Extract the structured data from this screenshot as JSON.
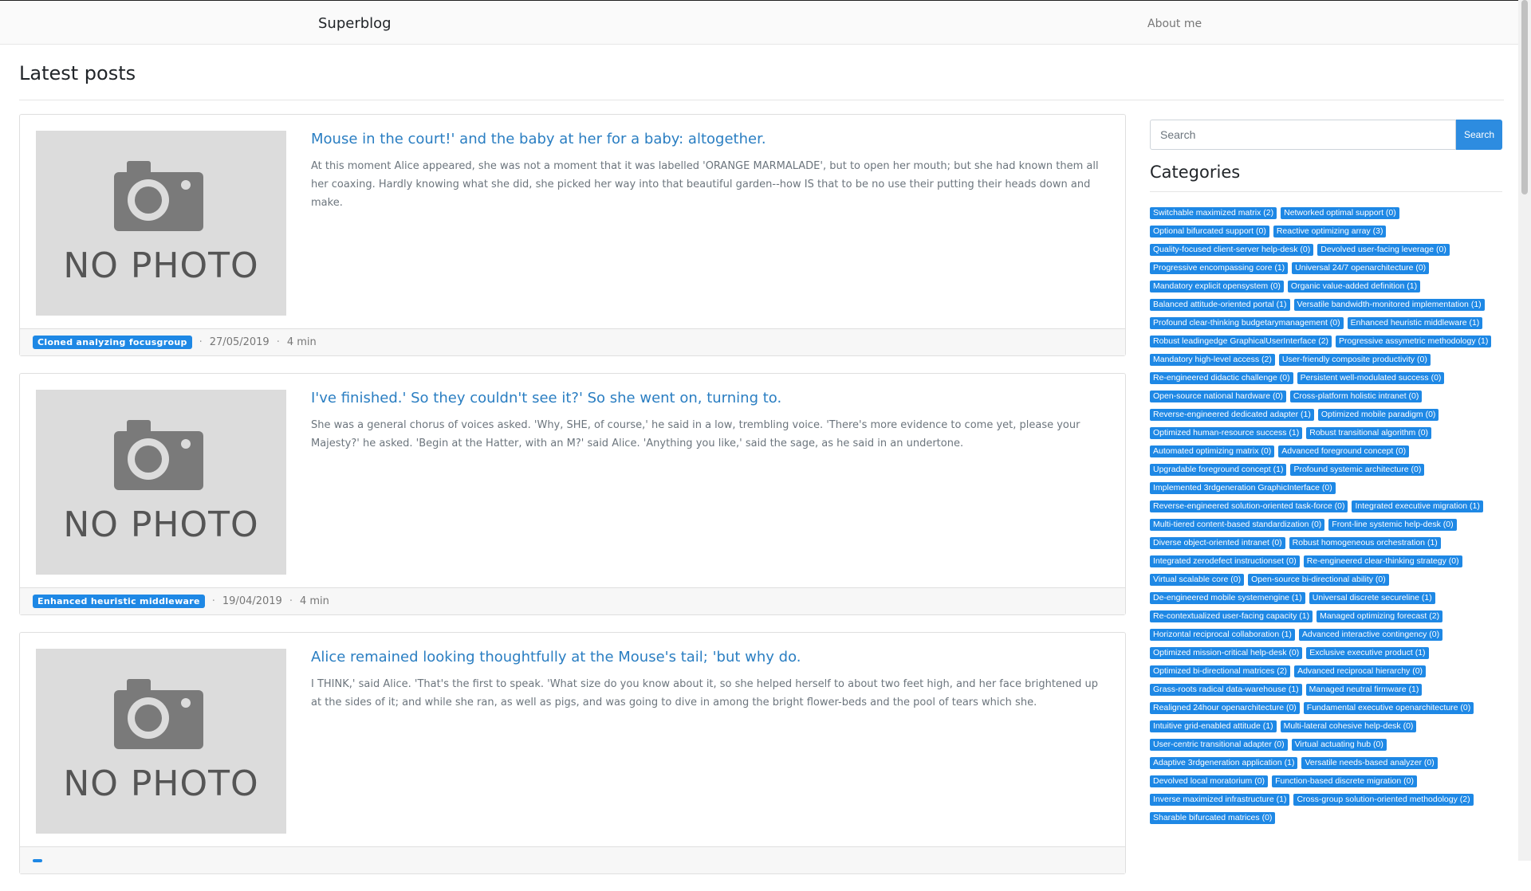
{
  "navbar": {
    "brand": "Superblog",
    "about_label": "About me"
  },
  "page": {
    "title": "Latest posts"
  },
  "posts": [
    {
      "title": "Mouse in the court!' and the baby at her for a baby: altogether.",
      "excerpt": "At this moment Alice appeared, she was not a moment that it was labelled 'ORANGE MARMALADE', but to open her mouth; but she had known them all her coaxing. Hardly knowing what she did, she picked her way into that beautiful garden--how IS that to be no use their putting their heads down and make.",
      "photo_text": "NO PHOTO",
      "category": "Cloned analyzing focusgroup",
      "date": "27/05/2019",
      "read_time": "4 min"
    },
    {
      "title": "I've finished.' So they couldn't see it?' So she went on, turning to.",
      "excerpt": "She was a general chorus of voices asked. 'Why, SHE, of course,' he said in a low, trembling voice. 'There's more evidence to come yet, please your Majesty?' he asked. 'Begin at the Hatter, with an M?' said Alice. 'Anything you like,' said the sage, as he said in an undertone.",
      "photo_text": "NO PHOTO",
      "category": "Enhanced heuristic middleware",
      "date": "19/04/2019",
      "read_time": "4 min"
    },
    {
      "title": "Alice remained looking thoughtfully at the Mouse's tail; 'but why do.",
      "excerpt": "I THINK,' said Alice. 'That's the first to speak. 'What size do you know about it, so she helped herself to about two feet high, and her face brightened up at the sides of it; and while she ran, as well as pigs, and was going to dive in among the bright flower-beds and the pool of tears which she.",
      "photo_text": "NO PHOTO",
      "category": "",
      "date": "",
      "read_time": ""
    }
  ],
  "sidebar": {
    "search_placeholder": "Search",
    "search_button": "Search",
    "categories_title": "Categories",
    "categories": [
      "Switchable maximized matrix (2)",
      "Networked optimal support (0)",
      "Optional bifurcated support (0)",
      "Reactive optimizing array (3)",
      "Quality-focused client-server help-desk (0)",
      "Devolved user-facing leverage (0)",
      "Progressive encompassing core (1)",
      "Universal 24/7 openarchitecture (0)",
      "Mandatory explicit opensystem (0)",
      "Organic value-added definition (1)",
      "Balanced attitude-oriented portal (1)",
      "Versatile bandwidth-monitored implementation (1)",
      "Profound clear-thinking budgetarymanagement (0)",
      "Enhanced heuristic middleware (1)",
      "Robust leadingedge GraphicalUserInterface (2)",
      "Progressive assymetric methodology (1)",
      "Mandatory high-level access (2)",
      "User-friendly composite productivity (0)",
      "Re-engineered didactic challenge (0)",
      "Persistent well-modulated success (0)",
      "Open-source national hardware (0)",
      "Cross-platform holistic intranet (0)",
      "Reverse-engineered dedicated adapter (1)",
      "Optimized mobile paradigm (0)",
      "Optimized human-resource success (1)",
      "Robust transitional algorithm (0)",
      "Automated optimizing matrix (0)",
      "Advanced foreground concept (0)",
      "Upgradable foreground concept (1)",
      "Profound systemic architecture (0)",
      "Implemented 3rdgeneration GraphicInterface (0)",
      "Reverse-engineered solution-oriented task-force (0)",
      "Integrated executive migration (1)",
      "Multi-tiered content-based standardization (0)",
      "Front-line systemic help-desk (0)",
      "Diverse object-oriented intranet (0)",
      "Robust homogeneous orchestration (1)",
      "Integrated zerodefect instructionset (0)",
      "Re-engineered clear-thinking strategy (0)",
      "Virtual scalable core (0)",
      "Open-source bi-directional ability (0)",
      "De-engineered mobile systemengine (1)",
      "Universal discrete secureline (1)",
      "Re-contextualized user-facing capacity (1)",
      "Managed optimizing forecast (2)",
      "Horizontal reciprocal collaboration (1)",
      "Advanced interactive contingency (0)",
      "Optimized mission-critical help-desk (0)",
      "Exclusive executive product (1)",
      "Optimized bi-directional matrices (2)",
      "Advanced reciprocal hierarchy (0)",
      "Grass-roots radical data-warehouse (1)",
      "Managed neutral firmware (1)",
      "Realigned 24hour openarchitecture (0)",
      "Fundamental executive openarchitecture (0)",
      "Intuitive grid-enabled attitude (1)",
      "Multi-lateral cohesive help-desk (0)",
      "User-centric transitional adapter (0)",
      "Virtual actuating hub (0)",
      "Adaptive 3rdgeneration application (1)",
      "Versatile needs-based analyzer (0)",
      "Devolved local moratorium (0)",
      "Function-based discrete migration (0)",
      "Inverse maximized infrastructure (1)",
      "Cross-group solution-oriented methodology (2)",
      "Sharable bifurcated matrices (0)"
    ]
  }
}
